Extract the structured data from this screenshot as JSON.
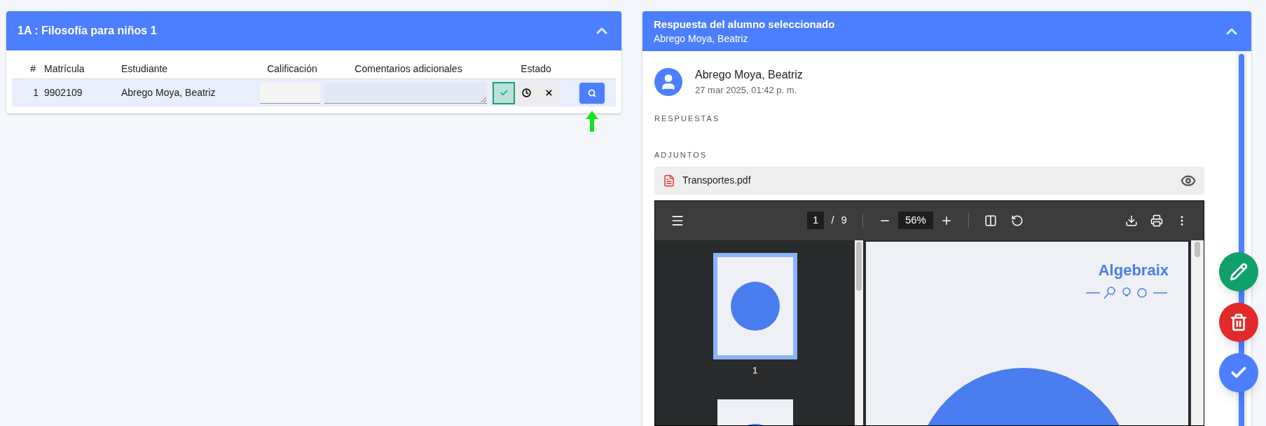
{
  "group_panel": {
    "title": "1A : Filosofía para niños 1",
    "expanded": true,
    "table": {
      "columns": [
        "#",
        "Matrícula",
        "Estudiante",
        "Calificación",
        "Comentarios adicionales",
        "Estado"
      ],
      "rows": [
        {
          "number": "1",
          "matricula": "9902109",
          "student": "Abrego Moya, Beatriz",
          "selected": true,
          "status_options": [
            {
              "kind": "approved",
              "selected": true
            },
            {
              "kind": "pending",
              "selected": false
            },
            {
              "kind": "rejected",
              "selected": false
            }
          ]
        }
      ]
    }
  },
  "response_panel": {
    "title": "Respuesta del alumno seleccionado",
    "subtitle": "Abrego Moya, Beatriz",
    "expanded": true,
    "author": {
      "name": "Abrego Moya, Beatriz",
      "date": "27 mar 2025, 01:42 p. m."
    },
    "answers_label": "RESPUESTAS",
    "attachments_label": "ADJUNTOS",
    "attachments": [
      {
        "file": "Transportes.pdf"
      }
    ],
    "pdf_viewer": {
      "page": "1",
      "separator": "/",
      "pages": "9",
      "zoom": "56%",
      "thumbnails": [
        {
          "label": "1",
          "selected": true
        },
        {
          "selected": false
        }
      ],
      "logo": "Algebraix"
    }
  },
  "fab_buttons": [
    {
      "kind": "edit"
    },
    {
      "kind": "delete"
    },
    {
      "kind": "confirm"
    }
  ]
}
